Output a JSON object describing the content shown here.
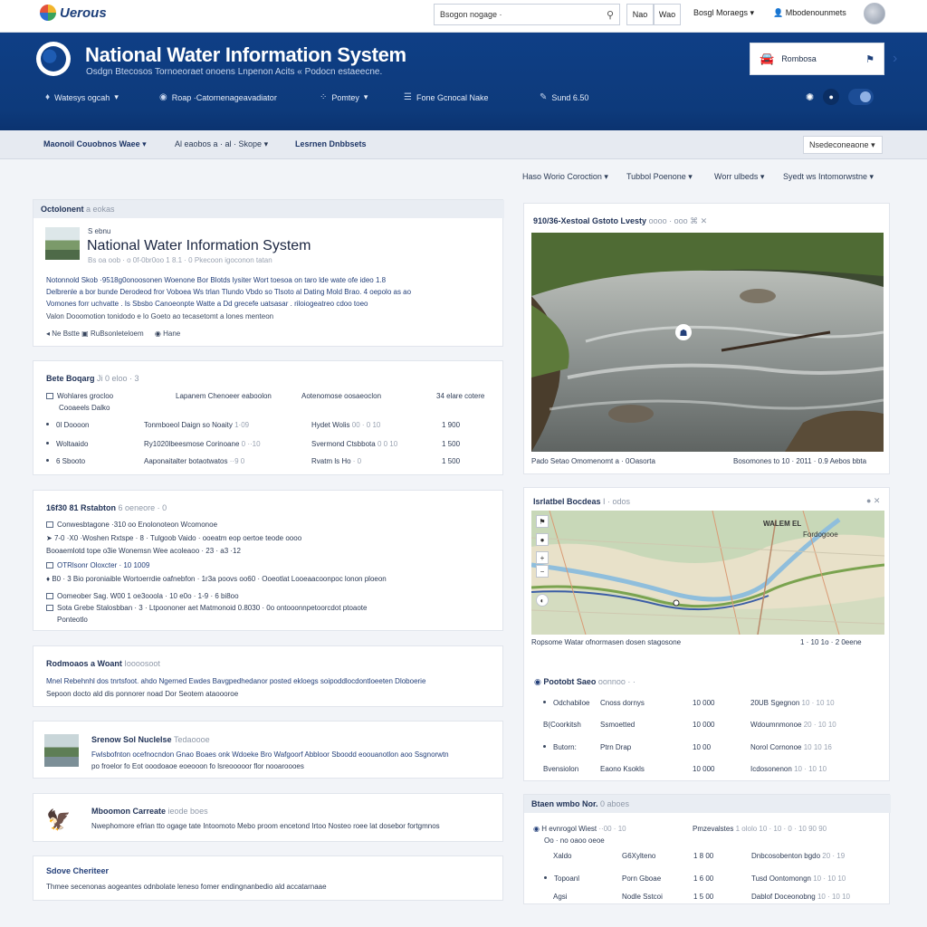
{
  "topbar": {
    "logo_text": "Uerous",
    "search_value": "Bsogon nogage ·",
    "btn1": "Nao",
    "btn2": "Wao",
    "link1": "Bosgl Moraegs",
    "link2": "Mbodenounmets"
  },
  "header": {
    "title": "National Water Information System",
    "subtitle": "Osdgn Btecosos Tornoeoraet onoens Lnpenon Acits « Podocn estaeecne.",
    "box_label": "Rombosa",
    "nav": [
      "Watesys ogcah",
      "Roap ·Catornenageavadiator",
      "Pomtey",
      "Fone Gcnocal Nake",
      "Sund 6.50"
    ]
  },
  "subnav": {
    "item1": "Maonoil Couobnos Waee",
    "item2": "Al eaobos a · al · Skope",
    "item3": "Lesrnen Dnbbsets",
    "select": "Nsedeconeaone"
  },
  "filters": [
    "Haso Worio Coroction",
    "Tubbol Poenone",
    "Worr ulbeds",
    "Syedt ws Intomorwstne"
  ],
  "overview": {
    "header": "Octolonent",
    "header_muted": "a eokas",
    "eyebrow": "S ebnu",
    "title": "National Water Information System",
    "meta": "Bs oa oob · o 0f-0br0oo 1 8.1 · 0 Pkecoon igoconon tatan",
    "body1": "Notonnold Skob ·9518g0onoosonen Woenone Bor Blotds lysiter Wort toesoa on taro lde wate ofe ideo 1.8",
    "body2": "Delbrenle a bor bunde Derodeod fror Voboea Ws trlan Tlundo Vbdo so Tlsoto al Dating Mold Brao. 4 oepolo as ao",
    "body3": "Vomones forr uchvatte . Is Sbsbo Canoeonpte Watte a Dd grecefe uatsasar . riloiogeatreo cdoo toeo",
    "body4": "Valon Dooomotion tonidodo e lo Goeto ao tecasetomt a lones menteon",
    "link1": "Ne Bstte",
    "link2": "RuBsonleteloem",
    "link3": "Hane"
  },
  "data_sets": {
    "header": "Bete Boqarg",
    "header_muted": "Ji 0 eloo · 3",
    "col1": "Wohlares grocloo",
    "col2": "Lapanem Chenoeer eaboolon",
    "col3": "Aotenomose oosaeoclon",
    "col4": "34 elare cotere",
    "sub": "Cooaeels Dalko",
    "rows": [
      {
        "a": "0l Doooon",
        "b": "Tonmboeol Daign so Noaity",
        "bd": "1·09",
        "c": "Hydet Wolis",
        "cd": "00 · 0 10",
        "d": "1 900"
      },
      {
        "a": "Woltaaido",
        "b": "Ry1020lbeesmose Corinoane",
        "bd": "0 ··10",
        "c": "Svermond Ctsbbota",
        "cd": "0 0 10",
        "d": "1 500"
      },
      {
        "a": "6 Sbooto",
        "b": "Aaponaitalter botaotwatos",
        "bd": "··9 0",
        "c": "Rvatm ls Ho",
        "cd": "· 0",
        "d": "1 500"
      }
    ]
  },
  "stations": {
    "header": "16f30 81 Rstabton",
    "header_muted": "6 oeneore · 0",
    "lines": [
      "Conwesbtagone ·310 oo Enolonoteon Wcomonoe",
      "7-0 ·X0 ·Woshen Rxtspe · 8 · Tulgoob Vaido · ooeatm eop oertoe teode oooo",
      "Booaemlotd tope o3ie Wonemsn Wee acoleaoo · 23 · a3 ·12",
      "OTRlsonr Oloxcter · 10 1009",
      "B0 · 3 Bio poroniaible Wortoerrdie oafnebfon · 1r3a poovs oo60 · Ooeotlat Looeaacoonpoc lonon ploeon",
      "Oomeober Sag. W00 1 oe3ooola · 10 e0o · 1-9 · 6 bi8oo",
      "Sota Grebe Stalosbban · 3 · Ltpoononer aet Matmonoid 0.8030 · 0o ontooonnpetoorcdot ptoaote",
      "Ponteotlo"
    ]
  },
  "resources": {
    "header": "Rodmoaos a Woant",
    "header_muted": "Ioooosoot",
    "line1": "Mnel Rebehnhl dos tnrtsfoot. ahdo Ngerned Ewdes Bavgpedhedanor posted ekloegs soipoddlocdontloeeten Dloboerie",
    "line2": "Sepoon docto ald dis ponnorer noad Dor Seotem ataoooroe"
  },
  "news1": {
    "title": "Srenow Sol Nuclelse",
    "title_muted": "Tedaoooe",
    "line1": "Fwlsbofnton ocefnocndon Gnao Boaes onk Wdoeke Bro Wafgoorf Abbloor Sboodd eoouanotlon aoo Ssgnorwtn",
    "line2": "po froelor fo Eot ooodoaoe eoeooon fo lsreooooor flor nooaroooes"
  },
  "news2": {
    "title": "Mboomon Carreate",
    "title_muted": "ieode boes",
    "line1": "Nwephomore efrlan tto ogage tate Intoomoto Mebo proom encetond Irtoo Nosteo roee lat dosebor fortgmnos"
  },
  "news3": {
    "title": "Sdove Cheriteer",
    "line1": "Thmee secenonas aogeantes odnbolate leneso fomer endingnanbedio ald accatarnaae"
  },
  "photo_card": {
    "header": "910/36-Xestoal Gstoto Lvesty",
    "header_muted": "oooo · ooo",
    "caption_left": "Pado Setao Omomenomt a · 0Oasorta",
    "caption_right": "Bosomones to 10 · 2011 · 0.9 Aebos bbta"
  },
  "map_card": {
    "header": "Isrlatbel Bocdeas",
    "header_muted": "I · odos",
    "map_label1": "WALEM EL",
    "map_label2": "Fordogooe",
    "caption_left": "Ropsome Watar ofnormasen dosen stagosone",
    "caption_right": "1 · 10 1o · 2 0eene",
    "sub_header": "Pootobt Saeo",
    "sub_header_muted": "oonnoo · ·",
    "rows": [
      {
        "a": "Odchabiloe",
        "b": "Cnoss dornys",
        "c": "10 000",
        "d": "20UB Sgegnon",
        "e": "10 · 10 10"
      },
      {
        "a": "B(Coorkitsh",
        "b": "Ssmoetted",
        "c": "10 000",
        "d": "Wdoumnmonoe",
        "e": "20 · 10 10"
      },
      {
        "a": "Butorn:",
        "b": "Ptrn Drap",
        "c": "10 00",
        "d": "Norol Cornonoe",
        "e": "10 10 16"
      },
      {
        "a": "Bvensiolon",
        "b": "Eaono Ksokls",
        "c": "10 000",
        "d": "Icdosonenon",
        "e": "10 · 10 10"
      }
    ]
  },
  "bottom_card": {
    "header": "Btaen wmbo Nor.",
    "header_muted": "0 aboes",
    "sub1": "H evnrogol Wiest",
    "sub1_muted": "··00 · 10",
    "sub2": "Pmzevalstes",
    "sub2_muted": "1 ololo 10 · 10 · 0 · 10 90 90",
    "sub_line": "Oo · no oaoo oeoe",
    "rows": [
      {
        "a": "Xaldo",
        "b": "G6Xylteno",
        "c": "1 8 00",
        "d": "Dnbcosobenton bgdo",
        "e": "20 · 19"
      },
      {
        "a": "Topoanl",
        "b": "Porn Gboae",
        "c": "1 6 00",
        "d": "Tusd Oontomongn",
        "e": "10 · 10 10"
      },
      {
        "a": "Agsi",
        "b": "Nodle Sstcoi",
        "c": "1 5 00",
        "d": "Dablof Doceonobng",
        "e": "10 · 10 10"
      }
    ]
  },
  "colors": {
    "header_blue": "#0f3f86",
    "accent": "#24407a",
    "page_bg": "#f2f4f8"
  },
  "icons": [
    "search-icon",
    "globe-icon",
    "chevron-down-icon",
    "car-icon",
    "bell-icon",
    "sun-icon",
    "toggle-icon",
    "zoom-in-icon",
    "zoom-out-icon",
    "location-icon"
  ]
}
